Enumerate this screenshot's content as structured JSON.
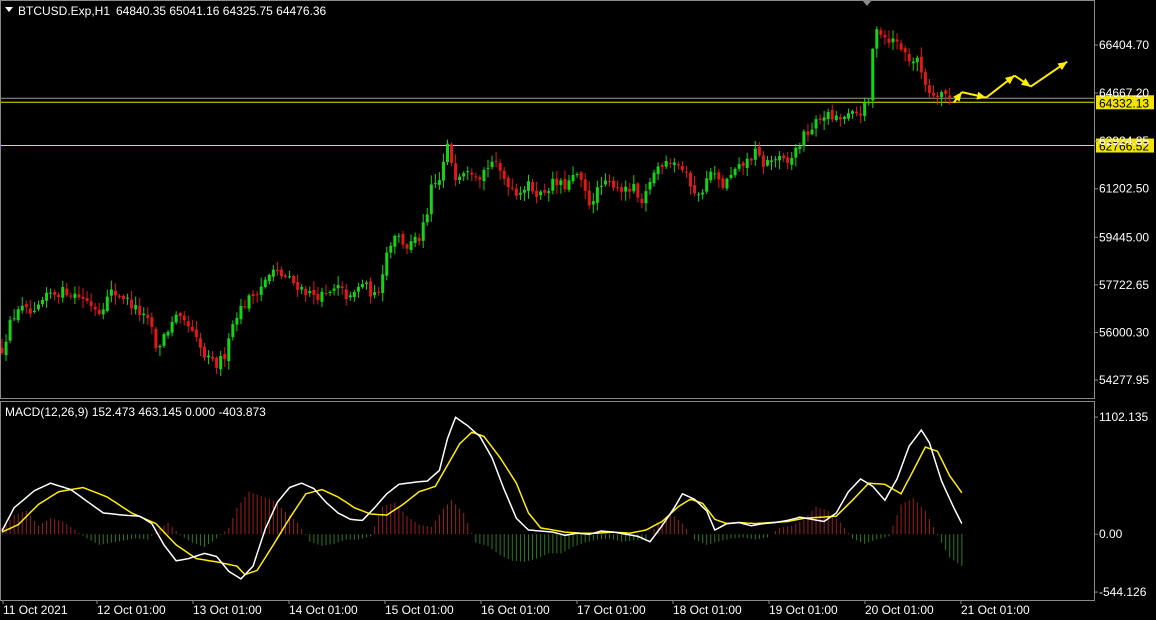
{
  "header": {
    "symbol": "BTCUSD.Exp,H1",
    "ohlc": "64840.35 65041.16 64325.75 64476.36"
  },
  "chart_data": [
    {
      "type": "candlestick",
      "title": "BTCUSD.Exp,H1",
      "ylim": [
        53700,
        67600
      ],
      "y_ticks": [
        "66404.70",
        "64667.20",
        "62924.85",
        "61202.50",
        "59445.00",
        "57722.65",
        "56000.30",
        "54277.95"
      ],
      "x_ticks": [
        "11 Oct 2021",
        "12 Oct 01:00",
        "13 Oct 01:00",
        "14 Oct 01:00",
        "15 Oct 01:00",
        "16 Oct 01:00",
        "17 Oct 01:00",
        "18 Oct 01:00",
        "19 Oct 01:00",
        "20 Oct 01:00",
        "21 Oct 01:00"
      ],
      "level_lines": [
        {
          "value": 64332.13,
          "label": "64332.13",
          "color": "#f0e400"
        },
        {
          "value": 62766.52,
          "label": "62766.52",
          "color": "#f0e400"
        }
      ],
      "gridline_value": 64480,
      "projection_arrows": {
        "color": "#ffee00",
        "points": [
          [
            235,
            64320
          ],
          [
            237,
            64700
          ],
          [
            243,
            64500
          ],
          [
            250,
            65300
          ],
          [
            254,
            64900
          ],
          [
            263,
            65800
          ]
        ]
      },
      "close_path": [
        [
          0,
          55400
        ],
        [
          2,
          56300
        ],
        [
          4,
          56900
        ],
        [
          8,
          56600
        ],
        [
          10,
          57100
        ],
        [
          12,
          57400
        ],
        [
          16,
          57500
        ],
        [
          20,
          57250
        ],
        [
          24,
          56800
        ],
        [
          27,
          57450
        ],
        [
          30,
          57300
        ],
        [
          34,
          56700
        ],
        [
          37,
          56200
        ],
        [
          38,
          55300
        ],
        [
          40,
          55900
        ],
        [
          43,
          56500
        ],
        [
          46,
          56200
        ],
        [
          48,
          55700
        ],
        [
          50,
          55100
        ],
        [
          53,
          54800
        ],
        [
          55,
          55200
        ],
        [
          56,
          55900
        ],
        [
          58,
          56700
        ],
        [
          61,
          57200
        ],
        [
          64,
          57700
        ],
        [
          67,
          58200
        ],
        [
          70,
          58000
        ],
        [
          73,
          57700
        ],
        [
          76,
          57400
        ],
        [
          80,
          57300
        ],
        [
          83,
          57600
        ],
        [
          86,
          57200
        ],
        [
          89,
          57800
        ],
        [
          92,
          57300
        ],
        [
          93,
          57600
        ],
        [
          95,
          58900
        ],
        [
          97,
          59600
        ],
        [
          100,
          59100
        ],
        [
          103,
          59400
        ],
        [
          105,
          60200
        ],
        [
          106,
          61200
        ],
        [
          108,
          61500
        ],
        [
          110,
          62700
        ],
        [
          112,
          61700
        ],
        [
          115,
          62000
        ],
        [
          118,
          61700
        ],
        [
          121,
          62200
        ],
        [
          124,
          61600
        ],
        [
          127,
          61100
        ],
        [
          130,
          61300
        ],
        [
          133,
          61000
        ],
        [
          136,
          61400
        ],
        [
          139,
          61300
        ],
        [
          142,
          61700
        ],
        [
          145,
          60700
        ],
        [
          148,
          61300
        ],
        [
          151,
          61400
        ],
        [
          154,
          61100
        ],
        [
          156,
          61200
        ],
        [
          158,
          60500
        ],
        [
          160,
          61500
        ],
        [
          162,
          62000
        ],
        [
          164,
          62300
        ],
        [
          167,
          62100
        ],
        [
          170,
          61400
        ],
        [
          172,
          60900
        ],
        [
          175,
          61800
        ],
        [
          178,
          61300
        ],
        [
          181,
          61800
        ],
        [
          184,
          62200
        ],
        [
          186,
          62500
        ],
        [
          188,
          62100
        ],
        [
          191,
          62300
        ],
        [
          194,
          62100
        ],
        [
          196,
          62600
        ],
        [
          198,
          63100
        ],
        [
          200,
          63400
        ],
        [
          203,
          63900
        ],
        [
          206,
          63700
        ],
        [
          209,
          63800
        ],
        [
          212,
          64000
        ],
        [
          214,
          64300
        ],
        [
          215,
          66200
        ],
        [
          216,
          67100
        ],
        [
          218,
          66700
        ],
        [
          221,
          66500
        ],
        [
          224,
          65900
        ],
        [
          226,
          65800
        ],
        [
          229,
          64700
        ],
        [
          232,
          64700
        ],
        [
          234,
          64480
        ]
      ]
    },
    {
      "type": "line",
      "title": "MACD(12,26,9) 152.473 463.145 0.000 -403.873",
      "ylim": [
        -600,
        1150
      ],
      "y_ticks": [
        "1102.135",
        "0.00",
        "-544.126"
      ],
      "macd_color": "#ffffff",
      "signal_color": "#ffee00",
      "hist_up_color": "#9b1f1f",
      "hist_down_color": "#2e7a1e",
      "macd_path": [
        [
          0,
          30
        ],
        [
          3,
          250
        ],
        [
          8,
          410
        ],
        [
          12,
          480
        ],
        [
          17,
          420
        ],
        [
          21,
          310
        ],
        [
          25,
          200
        ],
        [
          30,
          180
        ],
        [
          34,
          170
        ],
        [
          37,
          100
        ],
        [
          40,
          -100
        ],
        [
          43,
          -250
        ],
        [
          46,
          -230
        ],
        [
          50,
          -180
        ],
        [
          53,
          -210
        ],
        [
          56,
          -350
        ],
        [
          59,
          -420
        ],
        [
          62,
          -300
        ],
        [
          65,
          50
        ],
        [
          68,
          300
        ],
        [
          71,
          440
        ],
        [
          74,
          480
        ],
        [
          77,
          430
        ],
        [
          80,
          300
        ],
        [
          83,
          200
        ],
        [
          86,
          140
        ],
        [
          89,
          130
        ],
        [
          92,
          250
        ],
        [
          95,
          380
        ],
        [
          98,
          470
        ],
        [
          102,
          490
        ],
        [
          105,
          500
        ],
        [
          108,
          600
        ],
        [
          110,
          900
        ],
        [
          112,
          1100
        ],
        [
          115,
          1020
        ],
        [
          118,
          920
        ],
        [
          121,
          720
        ],
        [
          124,
          420
        ],
        [
          127,
          150
        ],
        [
          130,
          40
        ],
        [
          133,
          30
        ],
        [
          136,
          20
        ],
        [
          139,
          -10
        ],
        [
          142,
          10
        ],
        [
          145,
          0
        ],
        [
          148,
          30
        ],
        [
          151,
          20
        ],
        [
          154,
          0
        ],
        [
          157,
          -20
        ],
        [
          160,
          -70
        ],
        [
          163,
          80
        ],
        [
          166,
          250
        ],
        [
          168,
          380
        ],
        [
          171,
          330
        ],
        [
          174,
          220
        ],
        [
          176,
          40
        ],
        [
          179,
          100
        ],
        [
          182,
          110
        ],
        [
          185,
          80
        ],
        [
          188,
          100
        ],
        [
          191,
          110
        ],
        [
          194,
          130
        ],
        [
          197,
          160
        ],
        [
          200,
          140
        ],
        [
          203,
          120
        ],
        [
          206,
          200
        ],
        [
          209,
          400
        ],
        [
          212,
          520
        ],
        [
          215,
          450
        ],
        [
          218,
          320
        ],
        [
          221,
          520
        ],
        [
          224,
          830
        ],
        [
          227,
          980
        ],
        [
          229,
          860
        ],
        [
          232,
          500
        ],
        [
          235,
          250
        ],
        [
          237,
          100
        ]
      ],
      "signal_path": [
        [
          0,
          20
        ],
        [
          4,
          90
        ],
        [
          9,
          280
        ],
        [
          14,
          400
        ],
        [
          20,
          440
        ],
        [
          26,
          350
        ],
        [
          32,
          200
        ],
        [
          38,
          100
        ],
        [
          43,
          -100
        ],
        [
          48,
          -230
        ],
        [
          53,
          -260
        ],
        [
          58,
          -300
        ],
        [
          60,
          -380
        ],
        [
          63,
          -340
        ],
        [
          67,
          -100
        ],
        [
          71,
          150
        ],
        [
          75,
          380
        ],
        [
          79,
          420
        ],
        [
          83,
          350
        ],
        [
          87,
          250
        ],
        [
          91,
          190
        ],
        [
          95,
          180
        ],
        [
          99,
          280
        ],
        [
          103,
          400
        ],
        [
          107,
          450
        ],
        [
          110,
          650
        ],
        [
          113,
          850
        ],
        [
          116,
          960
        ],
        [
          119,
          920
        ],
        [
          123,
          720
        ],
        [
          127,
          480
        ],
        [
          130,
          200
        ],
        [
          133,
          60
        ],
        [
          136,
          40
        ],
        [
          139,
          20
        ],
        [
          143,
          10
        ],
        [
          147,
          10
        ],
        [
          151,
          20
        ],
        [
          155,
          10
        ],
        [
          159,
          40
        ],
        [
          163,
          120
        ],
        [
          167,
          260
        ],
        [
          170,
          330
        ],
        [
          173,
          290
        ],
        [
          176,
          140
        ],
        [
          179,
          100
        ],
        [
          182,
          110
        ],
        [
          186,
          100
        ],
        [
          190,
          110
        ],
        [
          194,
          120
        ],
        [
          198,
          150
        ],
        [
          202,
          160
        ],
        [
          206,
          170
        ],
        [
          210,
          320
        ],
        [
          214,
          480
        ],
        [
          218,
          470
        ],
        [
          222,
          380
        ],
        [
          225,
          600
        ],
        [
          228,
          820
        ],
        [
          231,
          780
        ],
        [
          234,
          550
        ],
        [
          237,
          390
        ]
      ],
      "histogram": [
        [
          0,
          60
        ],
        [
          3,
          180
        ],
        [
          6,
          220
        ],
        [
          9,
          80
        ],
        [
          12,
          150
        ],
        [
          15,
          120
        ],
        [
          18,
          40
        ],
        [
          21,
          -40
        ],
        [
          24,
          -100
        ],
        [
          27,
          -80
        ],
        [
          30,
          -60
        ],
        [
          33,
          -40
        ],
        [
          36,
          -50
        ],
        [
          39,
          60
        ],
        [
          41,
          110
        ],
        [
          44,
          -10
        ],
        [
          47,
          -80
        ],
        [
          50,
          -120
        ],
        [
          53,
          -40
        ],
        [
          56,
          60
        ],
        [
          58,
          250
        ],
        [
          61,
          400
        ],
        [
          64,
          360
        ],
        [
          67,
          320
        ],
        [
          70,
          210
        ],
        [
          73,
          110
        ],
        [
          76,
          -70
        ],
        [
          79,
          -110
        ],
        [
          82,
          -90
        ],
        [
          85,
          -50
        ],
        [
          88,
          -50
        ],
        [
          91,
          -20
        ],
        [
          94,
          260
        ],
        [
          97,
          300
        ],
        [
          100,
          170
        ],
        [
          103,
          90
        ],
        [
          106,
          70
        ],
        [
          109,
          240
        ],
        [
          111,
          320
        ],
        [
          114,
          200
        ],
        [
          117,
          -80
        ],
        [
          120,
          -110
        ],
        [
          123,
          -200
        ],
        [
          126,
          -250
        ],
        [
          129,
          -260
        ],
        [
          132,
          -230
        ],
        [
          135,
          -180
        ],
        [
          138,
          -180
        ],
        [
          141,
          -120
        ],
        [
          144,
          -80
        ],
        [
          147,
          -50
        ],
        [
          150,
          -40
        ],
        [
          153,
          -70
        ],
        [
          156,
          -60
        ],
        [
          159,
          -50
        ],
        [
          162,
          100
        ],
        [
          165,
          200
        ],
        [
          168,
          100
        ],
        [
          171,
          -50
        ],
        [
          174,
          -100
        ],
        [
          177,
          -70
        ],
        [
          180,
          -40
        ],
        [
          183,
          -30
        ],
        [
          186,
          -50
        ],
        [
          189,
          -30
        ],
        [
          192,
          60
        ],
        [
          195,
          80
        ],
        [
          198,
          140
        ],
        [
          201,
          260
        ],
        [
          204,
          220
        ],
        [
          207,
          110
        ],
        [
          210,
          -40
        ],
        [
          213,
          -90
        ],
        [
          216,
          -50
        ],
        [
          219,
          -20
        ],
        [
          222,
          280
        ],
        [
          225,
          340
        ],
        [
          228,
          220
        ],
        [
          231,
          -10
        ],
        [
          234,
          -220
        ],
        [
          237,
          -300
        ]
      ]
    }
  ]
}
